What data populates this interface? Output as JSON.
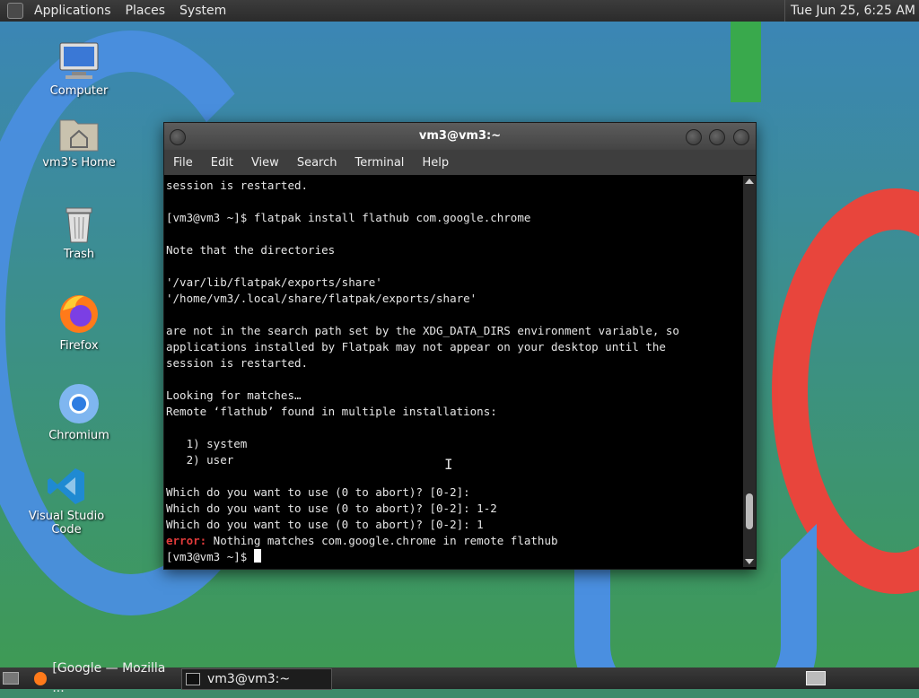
{
  "topbar": {
    "menus": [
      "Applications",
      "Places",
      "System"
    ],
    "clock": "Tue Jun 25, 6:25 AM"
  },
  "desktop": {
    "icons": [
      {
        "label": "Computer",
        "icon": "computer-icon"
      },
      {
        "label": "vm3's Home",
        "icon": "home-folder-icon"
      },
      {
        "label": "Trash",
        "icon": "trash-icon"
      },
      {
        "label": "Firefox",
        "icon": "firefox-icon"
      },
      {
        "label": "Chromium",
        "icon": "chromium-icon"
      },
      {
        "label": "Visual Studio Code",
        "icon": "vscode-icon"
      }
    ]
  },
  "terminal": {
    "title": "vm3@vm3:~",
    "menu": [
      "File",
      "Edit",
      "View",
      "Search",
      "Terminal",
      "Help"
    ],
    "lines": [
      "session is restarted.",
      "",
      "[vm3@vm3 ~]$ flatpak install flathub com.google.chrome",
      "",
      "Note that the directories",
      "",
      "'/var/lib/flatpak/exports/share'",
      "'/home/vm3/.local/share/flatpak/exports/share'",
      "",
      "are not in the search path set by the XDG_DATA_DIRS environment variable, so",
      "applications installed by Flatpak may not appear on your desktop until the",
      "session is restarted.",
      "",
      "Looking for matches…",
      "Remote ‘flathub’ found in multiple installations:",
      "",
      "   1) system",
      "   2) user",
      "",
      "Which do you want to use (0 to abort)? [0-2]:",
      "Which do you want to use (0 to abort)? [0-2]: 1-2",
      "Which do you want to use (0 to abort)? [0-2]: 1"
    ],
    "error_prefix": "error:",
    "error_message": " Nothing matches com.google.chrome in remote flathub",
    "prompt": "[vm3@vm3 ~]$ ",
    "scroll_position": 0.93
  },
  "taskbar": {
    "items": [
      {
        "label": "[Google — Mozilla ...",
        "icon": "firefox-icon"
      },
      {
        "label": "vm3@vm3:~",
        "icon": "terminal-icon"
      }
    ]
  },
  "colors": {
    "error": "#e23b3b",
    "terminal_bg": "#000000",
    "terminal_fg": "#e6e6e6"
  }
}
